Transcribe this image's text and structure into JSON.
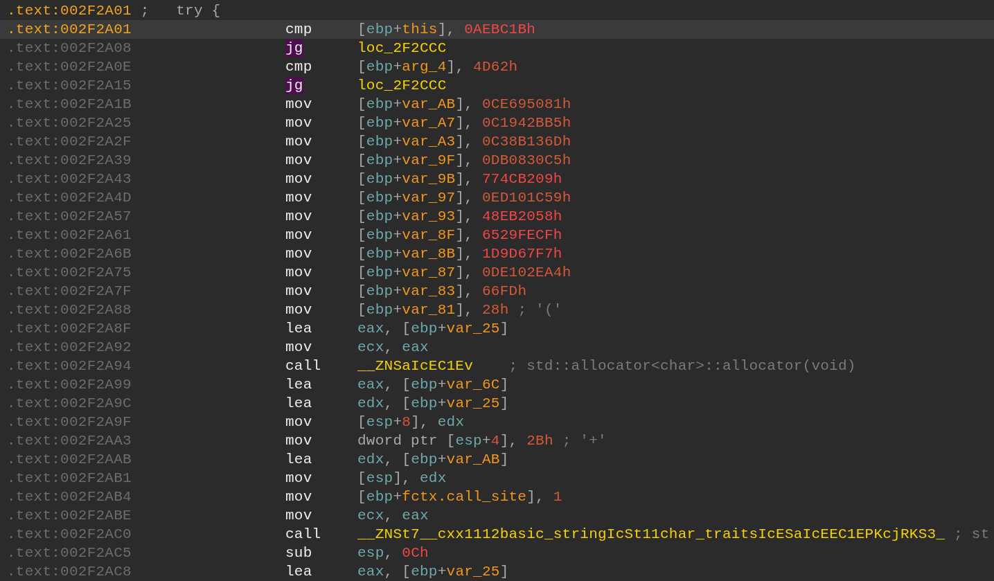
{
  "rows": [
    {
      "address": ".text:002F2A01",
      "selected": true,
      "current": false,
      "comment": ";   try {"
    },
    {
      "address": ".text:002F2A01",
      "selected": true,
      "current": true,
      "mnemonic": "cmp",
      "highlighted": false,
      "operands": [
        {
          "text": "[",
          "kind": "punct"
        },
        {
          "text": "ebp",
          "kind": "reg"
        },
        {
          "text": "+",
          "kind": "punct"
        },
        {
          "text": "this",
          "kind": "var"
        },
        {
          "text": "], ",
          "kind": "punct"
        },
        {
          "text": "0AEBC1Bh",
          "kind": "imm"
        }
      ]
    },
    {
      "address": ".text:002F2A08",
      "selected": false,
      "current": false,
      "mnemonic": "jg",
      "highlighted": true,
      "operands": [
        {
          "text": "loc_2F2CCC",
          "kind": "name"
        }
      ]
    },
    {
      "address": ".text:002F2A0E",
      "selected": false,
      "current": false,
      "mnemonic": "cmp",
      "highlighted": false,
      "operands": [
        {
          "text": "[",
          "kind": "punct"
        },
        {
          "text": "ebp",
          "kind": "reg"
        },
        {
          "text": "+",
          "kind": "punct"
        },
        {
          "text": "arg_4",
          "kind": "var"
        },
        {
          "text": "], ",
          "kind": "punct"
        },
        {
          "text": "4D62h",
          "kind": "num"
        }
      ]
    },
    {
      "address": ".text:002F2A15",
      "selected": false,
      "current": false,
      "mnemonic": "jg",
      "highlighted": true,
      "operands": [
        {
          "text": "loc_2F2CCC",
          "kind": "name"
        }
      ]
    },
    {
      "address": ".text:002F2A1B",
      "selected": false,
      "current": false,
      "mnemonic": "mov",
      "highlighted": false,
      "operands": [
        {
          "text": "[",
          "kind": "punct"
        },
        {
          "text": "ebp",
          "kind": "reg"
        },
        {
          "text": "+",
          "kind": "punct"
        },
        {
          "text": "var_AB",
          "kind": "var"
        },
        {
          "text": "], ",
          "kind": "punct"
        },
        {
          "text": "0CE695081h",
          "kind": "num"
        }
      ]
    },
    {
      "address": ".text:002F2A25",
      "selected": false,
      "current": false,
      "mnemonic": "mov",
      "highlighted": false,
      "operands": [
        {
          "text": "[",
          "kind": "punct"
        },
        {
          "text": "ebp",
          "kind": "reg"
        },
        {
          "text": "+",
          "kind": "punct"
        },
        {
          "text": "var_A7",
          "kind": "var"
        },
        {
          "text": "], ",
          "kind": "punct"
        },
        {
          "text": "0C1942BB5h",
          "kind": "num"
        }
      ]
    },
    {
      "address": ".text:002F2A2F",
      "selected": false,
      "current": false,
      "mnemonic": "mov",
      "highlighted": false,
      "operands": [
        {
          "text": "[",
          "kind": "punct"
        },
        {
          "text": "ebp",
          "kind": "reg"
        },
        {
          "text": "+",
          "kind": "punct"
        },
        {
          "text": "var_A3",
          "kind": "var"
        },
        {
          "text": "], ",
          "kind": "punct"
        },
        {
          "text": "0C38B136Dh",
          "kind": "num"
        }
      ]
    },
    {
      "address": ".text:002F2A39",
      "selected": false,
      "current": false,
      "mnemonic": "mov",
      "highlighted": false,
      "operands": [
        {
          "text": "[",
          "kind": "punct"
        },
        {
          "text": "ebp",
          "kind": "reg"
        },
        {
          "text": "+",
          "kind": "punct"
        },
        {
          "text": "var_9F",
          "kind": "var"
        },
        {
          "text": "], ",
          "kind": "punct"
        },
        {
          "text": "0DB0830C5h",
          "kind": "num"
        }
      ]
    },
    {
      "address": ".text:002F2A43",
      "selected": false,
      "current": false,
      "mnemonic": "mov",
      "highlighted": false,
      "operands": [
        {
          "text": "[",
          "kind": "punct"
        },
        {
          "text": "ebp",
          "kind": "reg"
        },
        {
          "text": "+",
          "kind": "punct"
        },
        {
          "text": "var_9B",
          "kind": "var"
        },
        {
          "text": "], ",
          "kind": "punct"
        },
        {
          "text": "774CB209h",
          "kind": "imm"
        }
      ]
    },
    {
      "address": ".text:002F2A4D",
      "selected": false,
      "current": false,
      "mnemonic": "mov",
      "highlighted": false,
      "operands": [
        {
          "text": "[",
          "kind": "punct"
        },
        {
          "text": "ebp",
          "kind": "reg"
        },
        {
          "text": "+",
          "kind": "punct"
        },
        {
          "text": "var_97",
          "kind": "var"
        },
        {
          "text": "], ",
          "kind": "punct"
        },
        {
          "text": "0ED101C59h",
          "kind": "num"
        }
      ]
    },
    {
      "address": ".text:002F2A57",
      "selected": false,
      "current": false,
      "mnemonic": "mov",
      "highlighted": false,
      "operands": [
        {
          "text": "[",
          "kind": "punct"
        },
        {
          "text": "ebp",
          "kind": "reg"
        },
        {
          "text": "+",
          "kind": "punct"
        },
        {
          "text": "var_93",
          "kind": "var"
        },
        {
          "text": "], ",
          "kind": "punct"
        },
        {
          "text": "48EB2058h",
          "kind": "imm"
        }
      ]
    },
    {
      "address": ".text:002F2A61",
      "selected": false,
      "current": false,
      "mnemonic": "mov",
      "highlighted": false,
      "operands": [
        {
          "text": "[",
          "kind": "punct"
        },
        {
          "text": "ebp",
          "kind": "reg"
        },
        {
          "text": "+",
          "kind": "punct"
        },
        {
          "text": "var_8F",
          "kind": "var"
        },
        {
          "text": "], ",
          "kind": "punct"
        },
        {
          "text": "6529FECFh",
          "kind": "imm"
        }
      ]
    },
    {
      "address": ".text:002F2A6B",
      "selected": false,
      "current": false,
      "mnemonic": "mov",
      "highlighted": false,
      "operands": [
        {
          "text": "[",
          "kind": "punct"
        },
        {
          "text": "ebp",
          "kind": "reg"
        },
        {
          "text": "+",
          "kind": "punct"
        },
        {
          "text": "var_8B",
          "kind": "var"
        },
        {
          "text": "], ",
          "kind": "punct"
        },
        {
          "text": "1D9D67F7h",
          "kind": "imm"
        }
      ]
    },
    {
      "address": ".text:002F2A75",
      "selected": false,
      "current": false,
      "mnemonic": "mov",
      "highlighted": false,
      "operands": [
        {
          "text": "[",
          "kind": "punct"
        },
        {
          "text": "ebp",
          "kind": "reg"
        },
        {
          "text": "+",
          "kind": "punct"
        },
        {
          "text": "var_87",
          "kind": "var"
        },
        {
          "text": "], ",
          "kind": "punct"
        },
        {
          "text": "0DE102EA4h",
          "kind": "num"
        }
      ]
    },
    {
      "address": ".text:002F2A7F",
      "selected": false,
      "current": false,
      "mnemonic": "mov",
      "highlighted": false,
      "operands": [
        {
          "text": "[",
          "kind": "punct"
        },
        {
          "text": "ebp",
          "kind": "reg"
        },
        {
          "text": "+",
          "kind": "punct"
        },
        {
          "text": "var_83",
          "kind": "var"
        },
        {
          "text": "], ",
          "kind": "punct"
        },
        {
          "text": "66FDh",
          "kind": "num"
        }
      ]
    },
    {
      "address": ".text:002F2A88",
      "selected": false,
      "current": false,
      "mnemonic": "mov",
      "highlighted": false,
      "operands": [
        {
          "text": "[",
          "kind": "punct"
        },
        {
          "text": "ebp",
          "kind": "reg"
        },
        {
          "text": "+",
          "kind": "punct"
        },
        {
          "text": "var_81",
          "kind": "var"
        },
        {
          "text": "], ",
          "kind": "punct"
        },
        {
          "text": "28h",
          "kind": "num"
        }
      ],
      "comment": "; '('"
    },
    {
      "address": ".text:002F2A8F",
      "selected": false,
      "current": false,
      "mnemonic": "lea",
      "highlighted": false,
      "operands": [
        {
          "text": "eax",
          "kind": "reg"
        },
        {
          "text": ", [",
          "kind": "punct"
        },
        {
          "text": "ebp",
          "kind": "reg"
        },
        {
          "text": "+",
          "kind": "punct"
        },
        {
          "text": "var_25",
          "kind": "var"
        },
        {
          "text": "]",
          "kind": "punct"
        }
      ]
    },
    {
      "address": ".text:002F2A92",
      "selected": false,
      "current": false,
      "mnemonic": "mov",
      "highlighted": false,
      "operands": [
        {
          "text": "ecx",
          "kind": "reg"
        },
        {
          "text": ", ",
          "kind": "punct"
        },
        {
          "text": "eax",
          "kind": "reg"
        }
      ]
    },
    {
      "address": ".text:002F2A94",
      "selected": false,
      "current": false,
      "mnemonic": "call",
      "highlighted": false,
      "operands": [
        {
          "text": "__ZNSaIcEC1Ev",
          "kind": "name"
        }
      ],
      "comment": "; std::allocator<char>::allocator(void)"
    },
    {
      "address": ".text:002F2A99",
      "selected": false,
      "current": false,
      "mnemonic": "lea",
      "highlighted": false,
      "operands": [
        {
          "text": "eax",
          "kind": "reg"
        },
        {
          "text": ", [",
          "kind": "punct"
        },
        {
          "text": "ebp",
          "kind": "reg"
        },
        {
          "text": "+",
          "kind": "punct"
        },
        {
          "text": "var_6C",
          "kind": "var"
        },
        {
          "text": "]",
          "kind": "punct"
        }
      ]
    },
    {
      "address": ".text:002F2A9C",
      "selected": false,
      "current": false,
      "mnemonic": "lea",
      "highlighted": false,
      "operands": [
        {
          "text": "edx",
          "kind": "reg"
        },
        {
          "text": ", [",
          "kind": "punct"
        },
        {
          "text": "ebp",
          "kind": "reg"
        },
        {
          "text": "+",
          "kind": "punct"
        },
        {
          "text": "var_25",
          "kind": "var"
        },
        {
          "text": "]",
          "kind": "punct"
        }
      ]
    },
    {
      "address": ".text:002F2A9F",
      "selected": false,
      "current": false,
      "mnemonic": "mov",
      "highlighted": false,
      "operands": [
        {
          "text": "[",
          "kind": "punct"
        },
        {
          "text": "esp",
          "kind": "reg"
        },
        {
          "text": "+",
          "kind": "punct"
        },
        {
          "text": "8",
          "kind": "num"
        },
        {
          "text": "], ",
          "kind": "punct"
        },
        {
          "text": "edx",
          "kind": "reg"
        }
      ]
    },
    {
      "address": ".text:002F2AA3",
      "selected": false,
      "current": false,
      "mnemonic": "mov",
      "highlighted": false,
      "operands": [
        {
          "text": "dword ptr [",
          "kind": "punct"
        },
        {
          "text": "esp",
          "kind": "reg"
        },
        {
          "text": "+",
          "kind": "punct"
        },
        {
          "text": "4",
          "kind": "num"
        },
        {
          "text": "], ",
          "kind": "punct"
        },
        {
          "text": "2Bh",
          "kind": "num"
        }
      ],
      "comment": "; '+'"
    },
    {
      "address": ".text:002F2AAB",
      "selected": false,
      "current": false,
      "mnemonic": "lea",
      "highlighted": false,
      "operands": [
        {
          "text": "edx",
          "kind": "reg"
        },
        {
          "text": ", [",
          "kind": "punct"
        },
        {
          "text": "ebp",
          "kind": "reg"
        },
        {
          "text": "+",
          "kind": "punct"
        },
        {
          "text": "var_AB",
          "kind": "var"
        },
        {
          "text": "]",
          "kind": "punct"
        }
      ]
    },
    {
      "address": ".text:002F2AB1",
      "selected": false,
      "current": false,
      "mnemonic": "mov",
      "highlighted": false,
      "operands": [
        {
          "text": "[",
          "kind": "punct"
        },
        {
          "text": "esp",
          "kind": "reg"
        },
        {
          "text": "], ",
          "kind": "punct"
        },
        {
          "text": "edx",
          "kind": "reg"
        }
      ]
    },
    {
      "address": ".text:002F2AB4",
      "selected": false,
      "current": false,
      "mnemonic": "mov",
      "highlighted": false,
      "operands": [
        {
          "text": "[",
          "kind": "punct"
        },
        {
          "text": "ebp",
          "kind": "reg"
        },
        {
          "text": "+",
          "kind": "punct"
        },
        {
          "text": "fctx.call_site",
          "kind": "var"
        },
        {
          "text": "], ",
          "kind": "punct"
        },
        {
          "text": "1",
          "kind": "num"
        }
      ]
    },
    {
      "address": ".text:002F2ABE",
      "selected": false,
      "current": false,
      "mnemonic": "mov",
      "highlighted": false,
      "operands": [
        {
          "text": "ecx",
          "kind": "reg"
        },
        {
          "text": ", ",
          "kind": "punct"
        },
        {
          "text": "eax",
          "kind": "reg"
        }
      ]
    },
    {
      "address": ".text:002F2AC0",
      "selected": false,
      "current": false,
      "mnemonic": "call",
      "highlighted": false,
      "operands": [
        {
          "text": "__ZNSt7__cxx1112basic_stringIcSt11char_traitsIcESaIcEEC1EPKcjRKS3_",
          "kind": "name"
        }
      ],
      "comment": "; st"
    },
    {
      "address": ".text:002F2AC5",
      "selected": false,
      "current": false,
      "mnemonic": "sub",
      "highlighted": false,
      "operands": [
        {
          "text": "esp",
          "kind": "reg"
        },
        {
          "text": ", ",
          "kind": "punct"
        },
        {
          "text": "0Ch",
          "kind": "imm"
        }
      ]
    },
    {
      "address": ".text:002F2AC8",
      "selected": false,
      "current": false,
      "mnemonic": "lea",
      "highlighted": false,
      "operands": [
        {
          "text": "eax",
          "kind": "reg"
        },
        {
          "text": ", [",
          "kind": "punct"
        },
        {
          "text": "ebp",
          "kind": "reg"
        },
        {
          "text": "+",
          "kind": "punct"
        },
        {
          "text": "var_25",
          "kind": "var"
        },
        {
          "text": "]",
          "kind": "punct"
        }
      ]
    }
  ]
}
